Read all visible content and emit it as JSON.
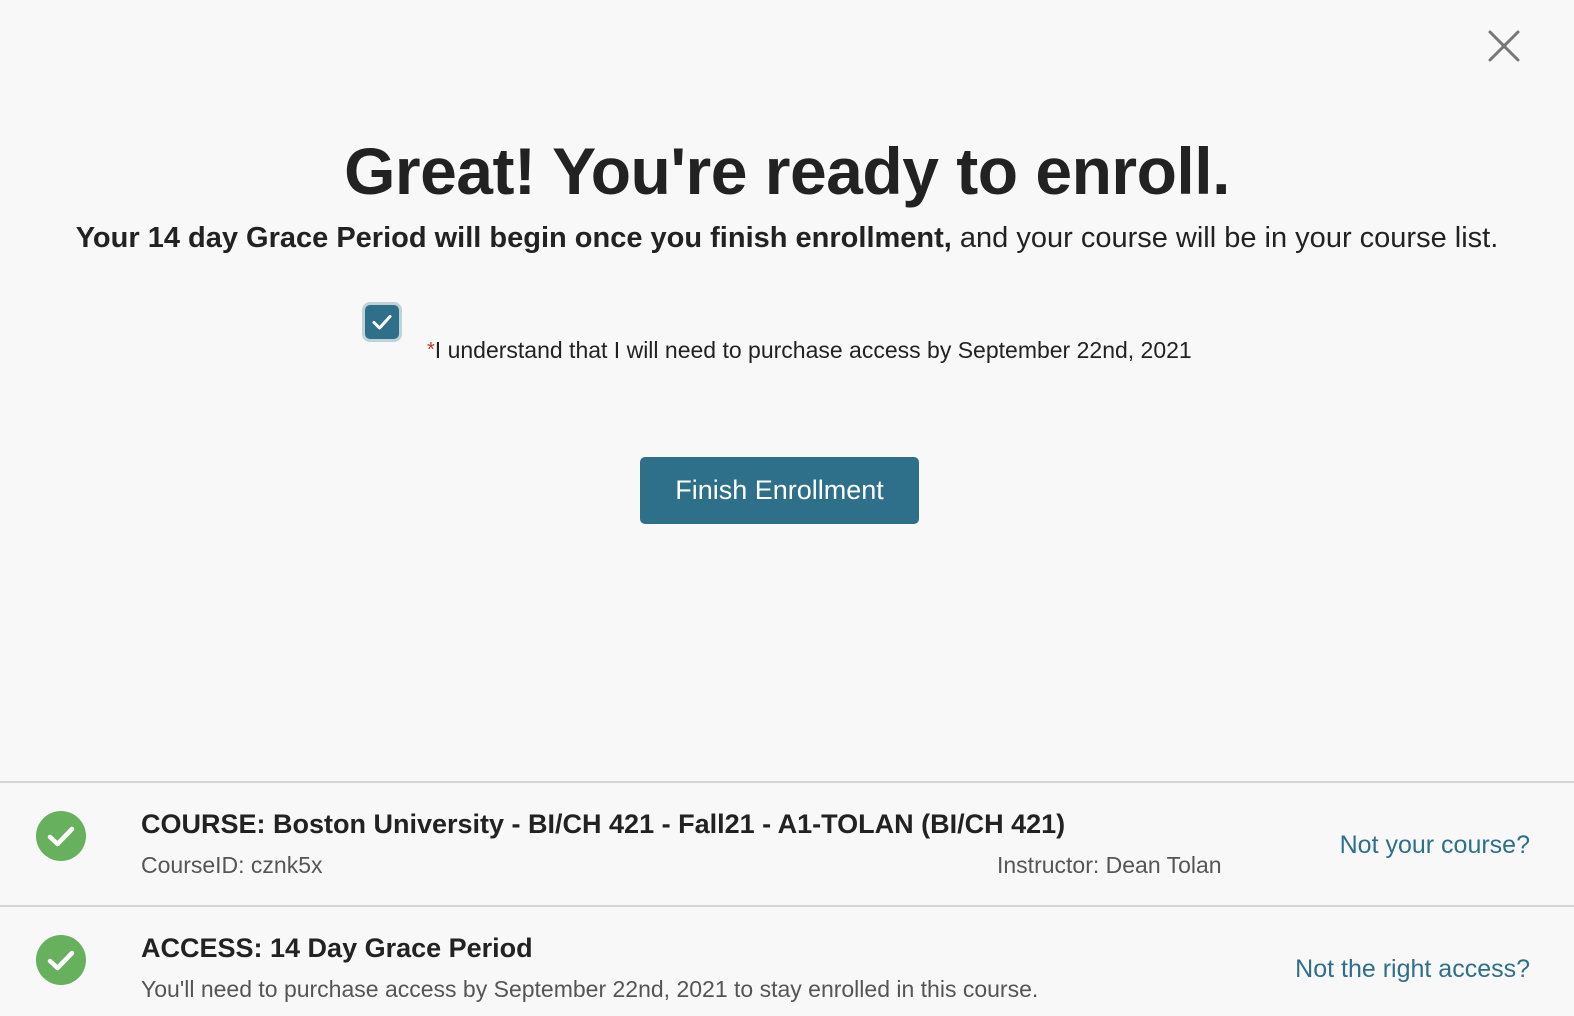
{
  "modal": {
    "title": "Great! You're ready to enroll.",
    "subtitle_bold": "Your 14 day Grace Period will begin once you finish enrollment,",
    "subtitle_rest": " and your course will be in your course list.",
    "acknowledgement": {
      "checked": true,
      "required_mark": "*",
      "label": "I understand that I will need to purchase access by September 22nd, 2021"
    },
    "finish_button": "Finish Enrollment"
  },
  "course": {
    "title": "COURSE: Boston University - BI/CH 421 - Fall21 - A1-TOLAN (BI/CH 421)",
    "course_id": "CourseID: cznk5x",
    "instructor": "Instructor: Dean Tolan",
    "link": "Not your course?",
    "status_icon": "check-circle-icon"
  },
  "access": {
    "title": "ACCESS: 14 Day Grace Period",
    "description": "You'll need to purchase access by September 22nd, 2021 to stay enrolled in this course.",
    "link": "Not the right access?",
    "status_icon": "check-circle-icon"
  },
  "colors": {
    "accent": "#2e6f8a",
    "success": "#67b05e",
    "required": "#c0392b",
    "background": "#f8f8f8"
  }
}
